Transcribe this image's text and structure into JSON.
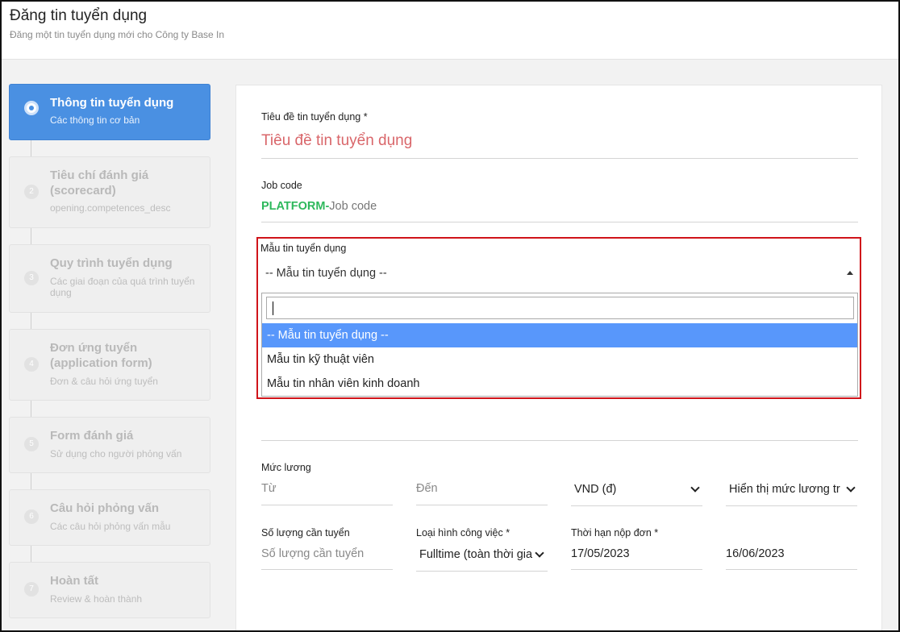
{
  "header": {
    "title": "Đăng tin tuyển dụng",
    "subtitle": "Đăng một tin tuyển dụng mới cho Công ty Base In"
  },
  "steps": [
    {
      "num": "",
      "label": "Thông tin tuyển dụng",
      "desc": "Các thông tin cơ bản",
      "active": true
    },
    {
      "num": "2",
      "label": "Tiêu chí đánh giá (scorecard)",
      "desc": "opening.competences_desc"
    },
    {
      "num": "3",
      "label": "Quy trình tuyển dụng",
      "desc": "Các giai đoạn của quá trình tuyển dụng"
    },
    {
      "num": "4",
      "label": "Đơn ứng tuyển (application form)",
      "desc": "Đơn & câu hỏi ứng tuyển"
    },
    {
      "num": "5",
      "label": "Form đánh giá",
      "desc": "Sử dụng cho người phỏng vấn"
    },
    {
      "num": "6",
      "label": "Câu hỏi phỏng vấn",
      "desc": "Các câu hỏi phỏng vấn mẫu"
    },
    {
      "num": "7",
      "label": "Hoàn tất",
      "desc": "Review & hoàn thành"
    }
  ],
  "form": {
    "title_label": "Tiêu đề tin tuyển dụng *",
    "title_placeholder": "Tiêu đề tin tuyển dụng",
    "jobcode_label": "Job code",
    "jobcode_prefix": "PLATFORM-",
    "jobcode_placeholder": "Job code",
    "template_label": "Mẫu tin tuyển dụng",
    "template_selected": "-- Mẫu tin tuyển dụng --",
    "template_options": [
      "-- Mẫu tin tuyển dụng --",
      "Mẫu tin kỹ thuật viên",
      "Mẫu tin nhân viên kinh doanh"
    ],
    "salary_label": "Mức lương",
    "salary_from_placeholder": "Từ",
    "salary_to_placeholder": "Đến",
    "currency_value": "VND (đ)",
    "salary_display_value": "Hiển thị mức lương tr",
    "quantity_label": "Số lượng cần tuyển",
    "quantity_placeholder": "Số lượng cần tuyển",
    "jobtype_label": "Loại hình công việc *",
    "jobtype_value": "Fulltime (toàn thời gia",
    "deadline_label": "Thời hạn nộp đơn *",
    "deadline_start": "17/05/2023",
    "deadline_end": "16/06/2023"
  },
  "colors": {
    "accent": "#4a90e2",
    "option_highlight": "#5897fb",
    "title_placeholder": "#d9666a",
    "jobcode_prefix": "#2eb85c",
    "highlight_border": "#d0141a"
  }
}
